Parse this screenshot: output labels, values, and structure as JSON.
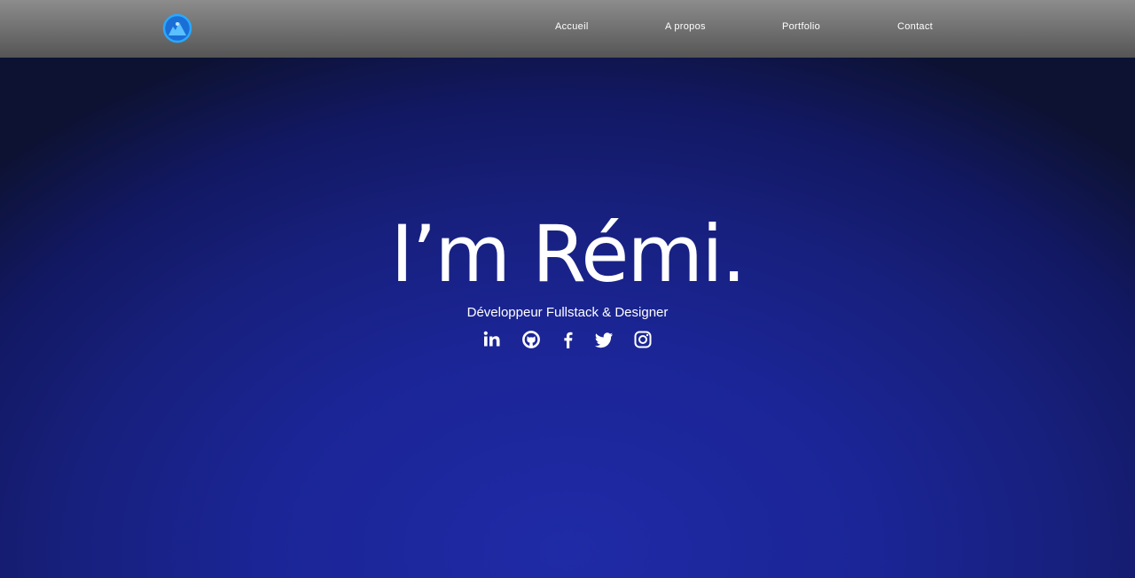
{
  "nav": {
    "logo_icon": "logo-icon",
    "links": [
      {
        "label": "Accueil"
      },
      {
        "label": "A propos"
      },
      {
        "label": "Portfolio"
      },
      {
        "label": "Contact"
      }
    ]
  },
  "hero": {
    "title": "I’m Rémi.",
    "subtitle": "Développeur Fullstack & Designer",
    "socials": [
      {
        "icon": "linkedin-icon"
      },
      {
        "icon": "github-icon"
      },
      {
        "icon": "facebook-icon"
      },
      {
        "icon": "twitter-icon"
      },
      {
        "icon": "instagram-icon"
      }
    ]
  },
  "colors": {
    "accent": "#1e90ff",
    "background": "#1b2596",
    "navbar": "#6e6e6e",
    "text": "#ffffff"
  }
}
